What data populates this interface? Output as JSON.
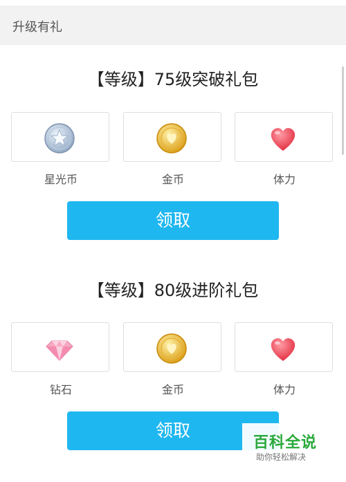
{
  "header": {
    "title": "升级有礼"
  },
  "packages": [
    {
      "title": "【等级】75级突破礼包",
      "items": [
        {
          "label": "星光币",
          "icon": "star-coin-icon"
        },
        {
          "label": "金币",
          "icon": "gold-coin-icon"
        },
        {
          "label": "体力",
          "icon": "heart-icon"
        }
      ],
      "button_label": "领取"
    },
    {
      "title": "【等级】80级进阶礼包",
      "items": [
        {
          "label": "钻石",
          "icon": "diamond-icon"
        },
        {
          "label": "金币",
          "icon": "gold-coin-icon"
        },
        {
          "label": "体力",
          "icon": "heart-icon"
        }
      ],
      "button_label": "领取"
    }
  ],
  "watermark": {
    "title": "百科全说",
    "subtitle": "助你轻松解决"
  },
  "colors": {
    "accent": "#1fb7f0",
    "header_bg": "#f2f2f2",
    "watermark_green": "#2aa93b"
  }
}
